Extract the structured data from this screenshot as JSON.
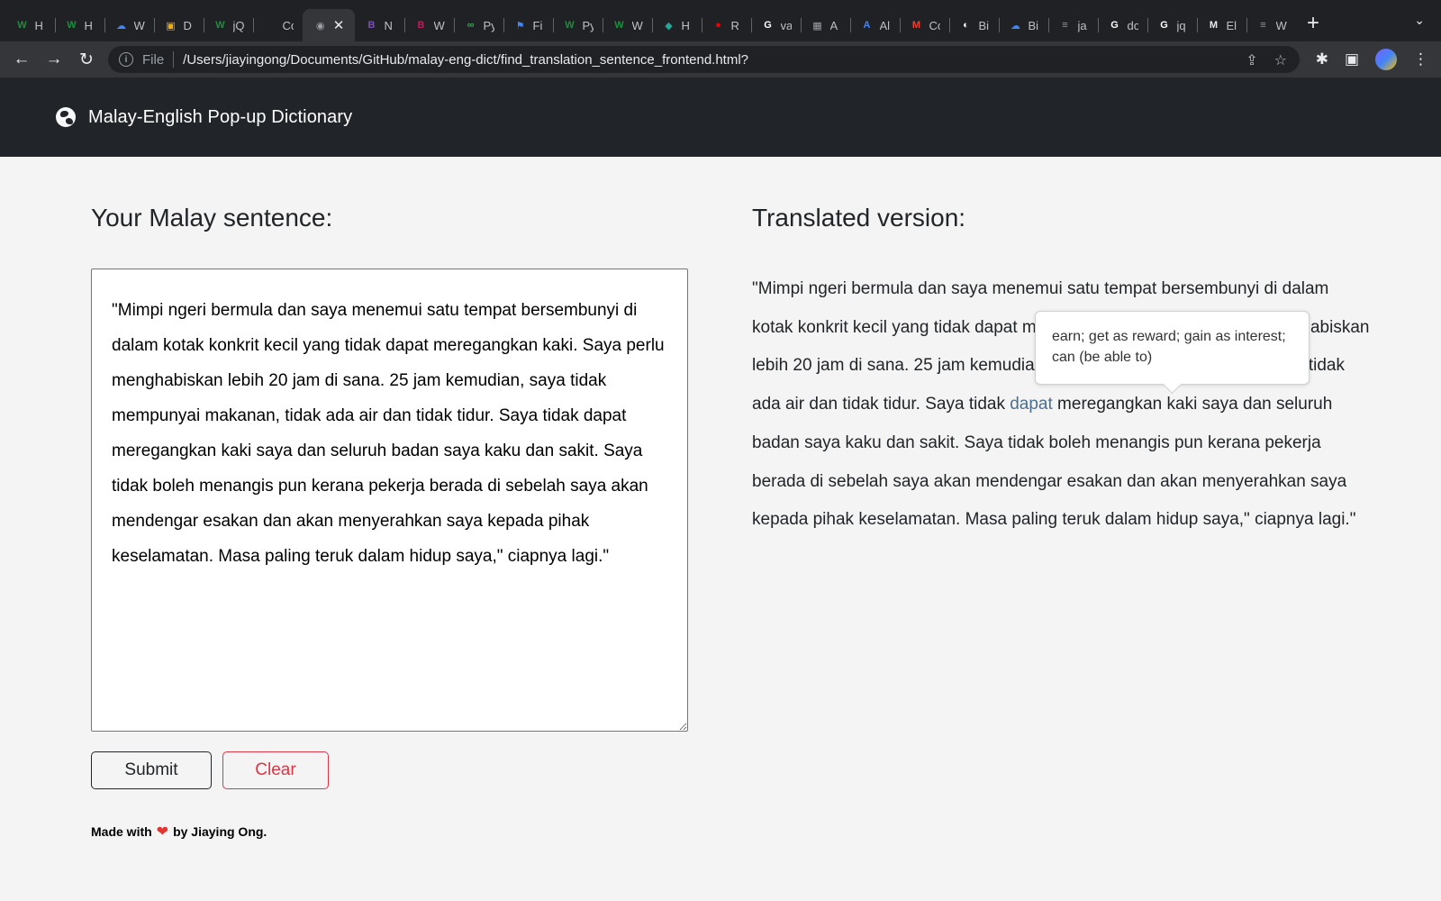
{
  "browser": {
    "tabs": [
      {
        "title": "H",
        "icon": "wiktionary-icon",
        "color": "#1e8e3e",
        "glyph": "W"
      },
      {
        "title": "H",
        "icon": "wiktionary-icon",
        "color": "#1e8e3e",
        "glyph": "W"
      },
      {
        "title": "W",
        "icon": "google-cloud-icon",
        "color": "#4285f4",
        "glyph": "☁"
      },
      {
        "title": "D",
        "icon": "box-icon",
        "color": "#f9ab00",
        "glyph": "▣"
      },
      {
        "title": "jQ",
        "icon": "wiktionary-icon",
        "color": "#1e8e3e",
        "glyph": "W"
      },
      {
        "title": "Co",
        "icon": "c-icon",
        "color": "#202124",
        "glyph": "C"
      },
      {
        "title": "",
        "icon": "globe-icon",
        "color": "#9aa0a6",
        "glyph": "◉",
        "active": true
      },
      {
        "title": "N",
        "icon": "bootstrap-icon",
        "color": "#7952b3",
        "glyph": "B"
      },
      {
        "title": "W",
        "icon": "bh-icon",
        "color": "#c2185b",
        "glyph": "B"
      },
      {
        "title": "Py",
        "icon": "link-icon",
        "color": "#34a853",
        "glyph": "∞"
      },
      {
        "title": "Fi",
        "icon": "flag-icon",
        "color": "#4285f4",
        "glyph": "⚑"
      },
      {
        "title": "Py",
        "icon": "wiktionary-icon",
        "color": "#1e8e3e",
        "glyph": "W"
      },
      {
        "title": "W",
        "icon": "wiktionary-icon",
        "color": "#1e8e3e",
        "glyph": "W"
      },
      {
        "title": "H",
        "icon": "cube-icon",
        "color": "#26a69a",
        "glyph": "◆"
      },
      {
        "title": "R",
        "icon": "redhat-icon",
        "color": "#ee0000",
        "glyph": "●"
      },
      {
        "title": "va",
        "icon": "google-icon",
        "color": "#ffffff",
        "glyph": "G"
      },
      {
        "title": "A",
        "icon": "image-icon",
        "color": "#9aa0a6",
        "glyph": "▦"
      },
      {
        "title": "Al",
        "icon": "ai-icon",
        "color": "#4285f4",
        "glyph": "A"
      },
      {
        "title": "Co",
        "icon": "gmail-icon",
        "color": "#ea4335",
        "glyph": "M"
      },
      {
        "title": "Bi",
        "icon": "github-icon",
        "color": "#ffffff",
        "glyph": "◐"
      },
      {
        "title": "Bi",
        "icon": "google-cloud-icon",
        "color": "#4285f4",
        "glyph": "☁"
      },
      {
        "title": "ja",
        "icon": "stackoverflow-icon",
        "color": "#f48024",
        "glyph": "≡"
      },
      {
        "title": "do",
        "icon": "google-icon",
        "color": "#ffffff",
        "glyph": "G"
      },
      {
        "title": "jq",
        "icon": "google-icon",
        "color": "#ffffff",
        "glyph": "G"
      },
      {
        "title": "El",
        "icon": "medium-icon",
        "color": "#e8eaed",
        "glyph": "M"
      },
      {
        "title": "W",
        "icon": "stackoverflow-icon",
        "color": "#f48024",
        "glyph": "≡"
      }
    ],
    "file_label": "File",
    "url": "/Users/jiayingong/Documents/GitHub/malay-eng-dict/find_translation_sentence_frontend.html?"
  },
  "navbar": {
    "brand": "Malay-English Pop-up Dictionary"
  },
  "left": {
    "title": "Your Malay sentence:",
    "input_text": "\"Mimpi ngeri bermula dan saya menemui satu tempat bersembunyi di dalam kotak konkrit kecil yang tidak dapat meregangkan kaki. Saya perlu menghabiskan lebih 20 jam di sana. 25 jam kemudian, saya tidak mempunyai makanan, tidak ada air dan tidak tidur. Saya tidak dapat meregangkan kaki saya dan seluruh badan saya kaku dan sakit. Saya tidak boleh menangis pun kerana pekerja berada di sebelah saya akan mendengar esakan dan akan menyerahkan saya kepada pihak keselamatan. Masa paling teruk dalam hidup saya,\" ciapnya lagi.\"",
    "submit_label": "Submit",
    "clear_label": "Clear"
  },
  "right": {
    "title": "Translated version:",
    "text_before": "\"Mimpi ngeri bermula dan saya menemui satu tempat bersembunyi di dalam kotak konkrit kecil yang tidak dapat meregangkan kaki. Saya perlu menghabiskan lebih 20 jam di sana. 25 jam kemudian, saya tidak mempunyai makanan, tidak ada air dan tidak tidur. Saya tidak ",
    "highlighted_word": "dapat",
    "text_after": " meregangkan kaki saya dan seluruh badan saya kaku dan sakit. Saya tidak boleh menangis pun kerana pekerja berada di sebelah saya akan mendengar esakan dan akan menyerahkan saya kepada pihak keselamatan. Masa paling teruk dalam hidup saya,\" ciapnya lagi.\"",
    "tooltip": "earn; get as reward; gain as interest; can (be able to)"
  },
  "footer": {
    "before": "Made with",
    "after": "by Jiaying Ong."
  },
  "colors": {
    "navbar": "#212529",
    "highlight": "#4c6f8f",
    "clear": "#dc3545",
    "heart": "#e3342f"
  }
}
